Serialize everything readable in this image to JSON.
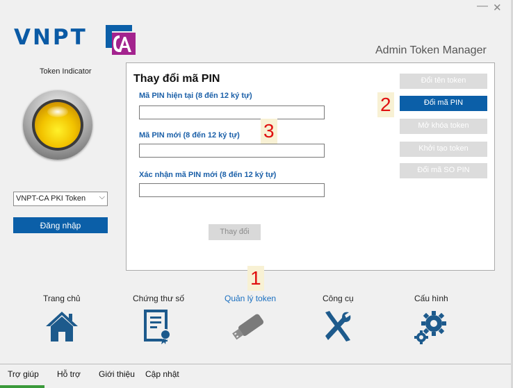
{
  "window": {
    "minimize": "—",
    "close": "✕"
  },
  "logo": {
    "text": "VNPT",
    "ca": "CA"
  },
  "app_title": "Admin Token Manager",
  "token_indicator": {
    "label": "Token Indicator",
    "status_color": "#f2c300"
  },
  "token_select": {
    "value": "VNPT-CA PKI Token"
  },
  "login_button": "Đăng nhập",
  "panel": {
    "title": "Thay đổi mã PIN",
    "fields": [
      {
        "label": "Mã PIN hiện tại (8 đến 12 ký tự)",
        "value": ""
      },
      {
        "label": "Mã PIN mới (8 đến 12 ký tự)",
        "value": ""
      },
      {
        "label": "Xác nhận mã PIN mới (8 đến 12 ký tự)",
        "value": ""
      }
    ],
    "submit": "Thay đổi",
    "side_buttons": [
      {
        "label": "Đổi tên token",
        "state": "disabled"
      },
      {
        "label": "Đổi mã PIN",
        "state": "active"
      },
      {
        "label": "Mở khóa token",
        "state": "disabled"
      },
      {
        "label": "Khởi tạo token",
        "state": "disabled"
      },
      {
        "label": "Đổi mã SO PIN",
        "state": "disabled"
      }
    ]
  },
  "markers": [
    "1",
    "2",
    "3"
  ],
  "nav": [
    {
      "label": "Trang chủ",
      "icon": "home-icon"
    },
    {
      "label": "Chứng thư số",
      "icon": "certificate-icon"
    },
    {
      "label": "Quản lý token",
      "icon": "usb-token-icon",
      "active": true
    },
    {
      "label": "Công cụ",
      "icon": "tools-icon"
    },
    {
      "label": "Cấu hình",
      "icon": "gears-icon"
    }
  ],
  "menu": [
    "Trợ giúp",
    "Hỗ trợ",
    "Giới thiệu",
    "Cập nhật"
  ],
  "colors": {
    "brand_blue": "#0b5fa8",
    "brand_magenta": "#a3238e",
    "marker_red": "#e01010"
  }
}
